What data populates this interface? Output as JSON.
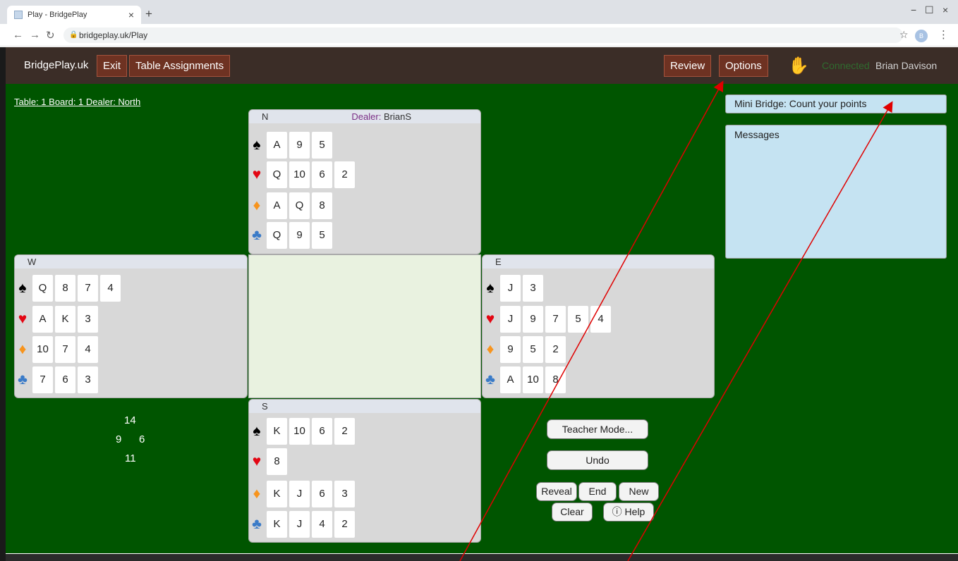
{
  "browser": {
    "tab_title": "Play - BridgePlay",
    "tab_close": "×",
    "new_tab": "+",
    "url": "bridgeplay.uk/Play",
    "profile_initial": "B",
    "window_min": "−",
    "window_max": "☐",
    "window_close": "×"
  },
  "nav": {
    "brand": "BridgePlay.uk",
    "exit": "Exit",
    "table_assignments": "Table Assignments",
    "review": "Review",
    "options": "Options",
    "connected": "Connected",
    "user": "Brian Davison"
  },
  "board_info": "Table: 1 Board: 1 Dealer: North",
  "hands": {
    "north": {
      "label": "N",
      "dealer_label": "Dealer:",
      "dealer_name": "BrianS",
      "spades": [
        "A",
        "9",
        "5"
      ],
      "hearts": [
        "Q",
        "10",
        "6",
        "2"
      ],
      "diamonds": [
        "A",
        "Q",
        "8"
      ],
      "clubs": [
        "Q",
        "9",
        "5"
      ]
    },
    "west": {
      "label": "W",
      "spades": [
        "Q",
        "8",
        "7",
        "4"
      ],
      "hearts": [
        "A",
        "K",
        "3"
      ],
      "diamonds": [
        "10",
        "7",
        "4"
      ],
      "clubs": [
        "7",
        "6",
        "3"
      ]
    },
    "east": {
      "label": "E",
      "spades": [
        "J",
        "3"
      ],
      "hearts": [
        "J",
        "9",
        "7",
        "5",
        "4"
      ],
      "diamonds": [
        "9",
        "5",
        "2"
      ],
      "clubs": [
        "A",
        "10",
        "8"
      ]
    },
    "south": {
      "label": "S",
      "spades": [
        "K",
        "10",
        "6",
        "2"
      ],
      "hearts": [
        "8"
      ],
      "diamonds": [
        "K",
        "J",
        "6",
        "3"
      ],
      "clubs": [
        "K",
        "J",
        "4",
        "2"
      ]
    }
  },
  "points": {
    "north": "14",
    "west": "9",
    "east": "6",
    "south": "11"
  },
  "controls": {
    "teacher_mode": "Teacher Mode...",
    "undo": "Undo",
    "reveal": "Reveal",
    "end": "End",
    "new": "New",
    "clear": "Clear",
    "help": "Help"
  },
  "info": {
    "mini_bridge": "Mini Bridge: Count your points",
    "messages": "Messages"
  },
  "colors": {
    "felt": "#005500",
    "nav_bg": "#3b2d27",
    "nav_button": "#6e3222",
    "panel_blue": "#c5e3f2",
    "annotation": "#e00000"
  }
}
